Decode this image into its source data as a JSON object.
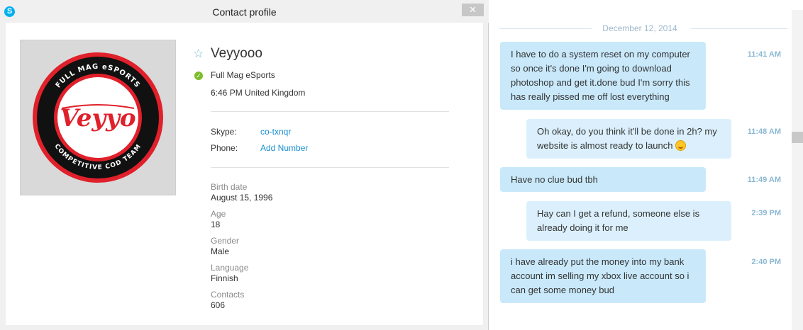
{
  "window": {
    "title": "Contact profile",
    "close_label": "✕"
  },
  "profile": {
    "avatar_logo": {
      "top_text": "FULL MAG eSPORTS",
      "center_text": "Veyyo",
      "bottom_text": "COMPETITIVE COD TEAM"
    },
    "name": "Veyyooo",
    "mood": "Full Mag eSports",
    "local_time": "6:46 PM United Kingdom",
    "skype_label": "Skype:",
    "skype_value": "co-txnqr",
    "phone_label": "Phone:",
    "phone_value": "Add Number",
    "birth_date_label": "Birth date",
    "birth_date_value": "August 15, 1996",
    "age_label": "Age",
    "age_value": "18",
    "gender_label": "Gender",
    "gender_value": "Male",
    "language_label": "Language",
    "language_value": "Finnish",
    "contacts_label": "Contacts",
    "contacts_value": "606"
  },
  "conversation": {
    "date": "December 12, 2014",
    "messages": [
      {
        "text": "I have to do a system reset on my computer so once it's done I'm going to download photoshop and get it.done bud I'm sorry this has really pissed me off lost everything",
        "time": "11:41 AM",
        "side": "sent"
      },
      {
        "text": "Oh okay, do you think it'll be done in 2h? my website is almost ready to launch",
        "time": "11:48 AM",
        "side": "recv",
        "emoji": "grin-emoji"
      },
      {
        "text": "Have no clue bud tbh",
        "time": "11:49 AM",
        "side": "sent"
      },
      {
        "text": "Hay can I get a refund, someone else is already doing it for me",
        "time": "2:39 PM",
        "side": "recv"
      },
      {
        "text": "i have already put the money into my bank account im selling my xbox live account so i can get some money bud",
        "time": "2:40 PM",
        "side": "sent"
      }
    ]
  },
  "colors": {
    "skype_blue": "#00aff0",
    "link_blue": "#1a8fd1",
    "online_green": "#7cbd2a",
    "bubble_sent": "#c9e9fb",
    "bubble_recv": "#dbf0fc",
    "logo_red": "#e0202a"
  }
}
